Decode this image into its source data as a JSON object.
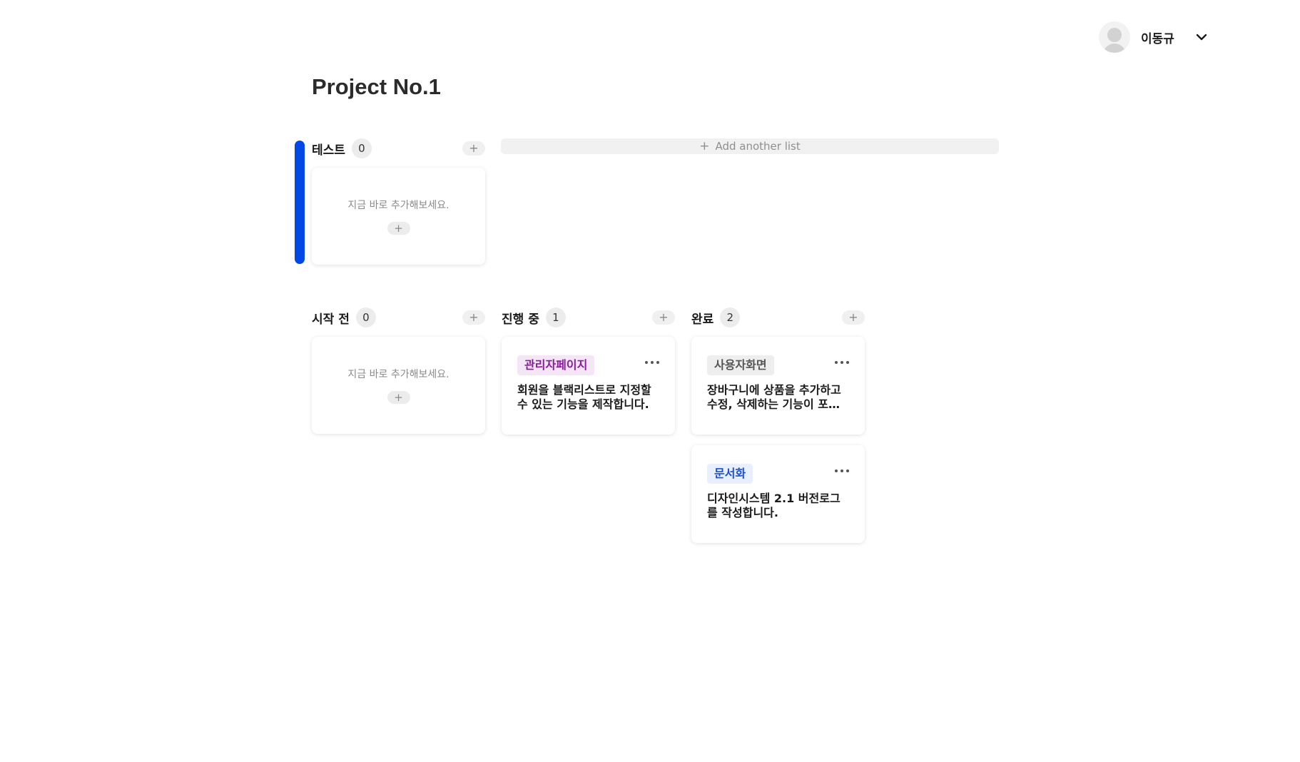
{
  "user": {
    "name": "이동규"
  },
  "project": {
    "title": "Project No.1"
  },
  "add_list_label": "Add another list",
  "colors": {
    "accent_blue": "#0049e6"
  },
  "lists": [
    {
      "title": "테스트",
      "count": "0",
      "empty_text": "지금 바로 추가해보세요."
    },
    {
      "title": "시작 전",
      "count": "0",
      "empty_text": "지금 바로 추가해보세요."
    },
    {
      "title": "진행 중",
      "count": "1",
      "cards": [
        {
          "tag": "관리자페이지",
          "tag_color": "#8a1a9e",
          "tag_bg": "#f4e6f7",
          "text": "회원을 블랙리스트로 지정할 수 있는 기능을 제작합니다."
        }
      ]
    },
    {
      "title": "완료",
      "count": "2",
      "cards": [
        {
          "tag": "사용자화면",
          "tag_color": "#555555",
          "tag_bg": "#eeeeee",
          "text": "장바구니에 상품을 추가하고 수정, 삭제하는 기능이 포함됩니다."
        },
        {
          "tag": "문서화",
          "tag_color": "#1b4fd6",
          "tag_bg": "#e8efff",
          "text": "디자인시스템 2.1 버전로그를 작성합니다."
        }
      ]
    }
  ]
}
